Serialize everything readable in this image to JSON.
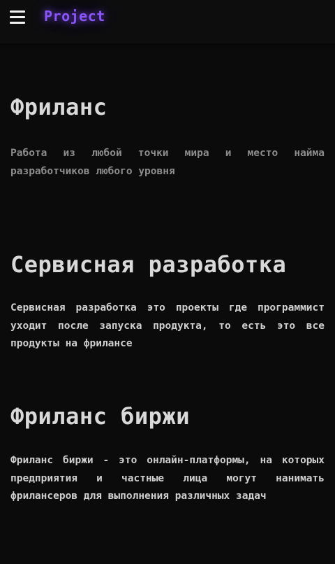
{
  "header": {
    "menu_icon": "hamburger-menu-icon",
    "brand": "Project",
    "brand_color": "#8a55ff"
  },
  "sections": [
    {
      "title": "Фриланс",
      "text": "Работа из любой точки мира и место найма разработчиков любого уровня"
    },
    {
      "title": "Сервисная разработка",
      "text": "Сервисная разработка это проекты где программист уходит после запуска продукта, то есть это все продукты на фрилансе"
    },
    {
      "title": "Фриланс биржи",
      "text": "Фриланс биржи - это онлайн-платформы, на которых предприятия и частные лица могут нанимать фрилансеров для выполнения различных задач"
    }
  ]
}
